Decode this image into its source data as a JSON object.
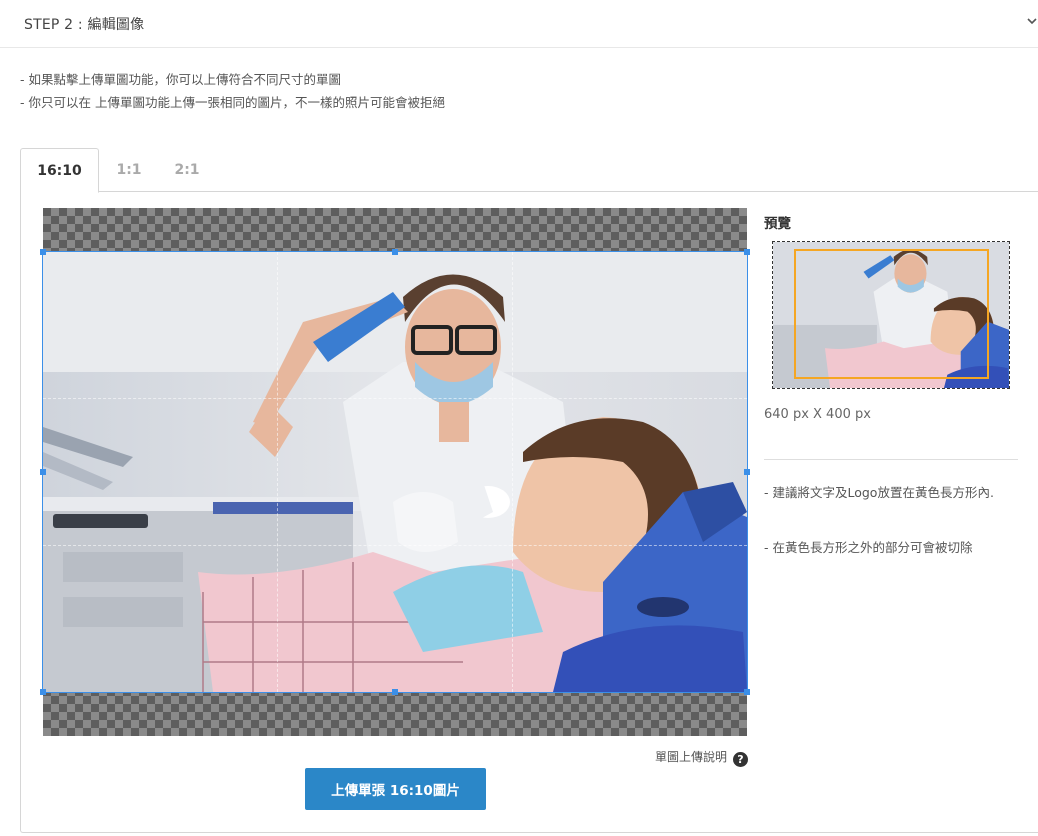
{
  "step": {
    "title": "STEP 2 : 編輯圖像",
    "toggle_icon": "chevron-down-icon"
  },
  "notes": [
    "- 如果點擊上傳單圖功能，你可以上傳符合不同尺寸的單圖",
    "- 你只可以在 上傳單圖功能上傳一張相同的圖片，不一樣的照片可能會被拒絕"
  ],
  "tabs": [
    {
      "label": "16:10",
      "active": true
    },
    {
      "label": "1:1",
      "active": false
    },
    {
      "label": "2:1",
      "active": false
    }
  ],
  "editor": {
    "help_label": "單圖上傳說明",
    "help_icon": "question-circle-icon",
    "upload_button": "上傳單張 16:10圖片",
    "crop_color": "#3b8fe8"
  },
  "preview": {
    "title": "預覽",
    "dimensions": "640 px X 400 px",
    "safe_area_color": "#f5a623",
    "tips": [
      "- 建議將文字及Logo放置在黃色長方形內.",
      "- 在黃色長方形之外的部分可會被切除"
    ]
  },
  "colors": {
    "accent": "#2b87c8"
  }
}
